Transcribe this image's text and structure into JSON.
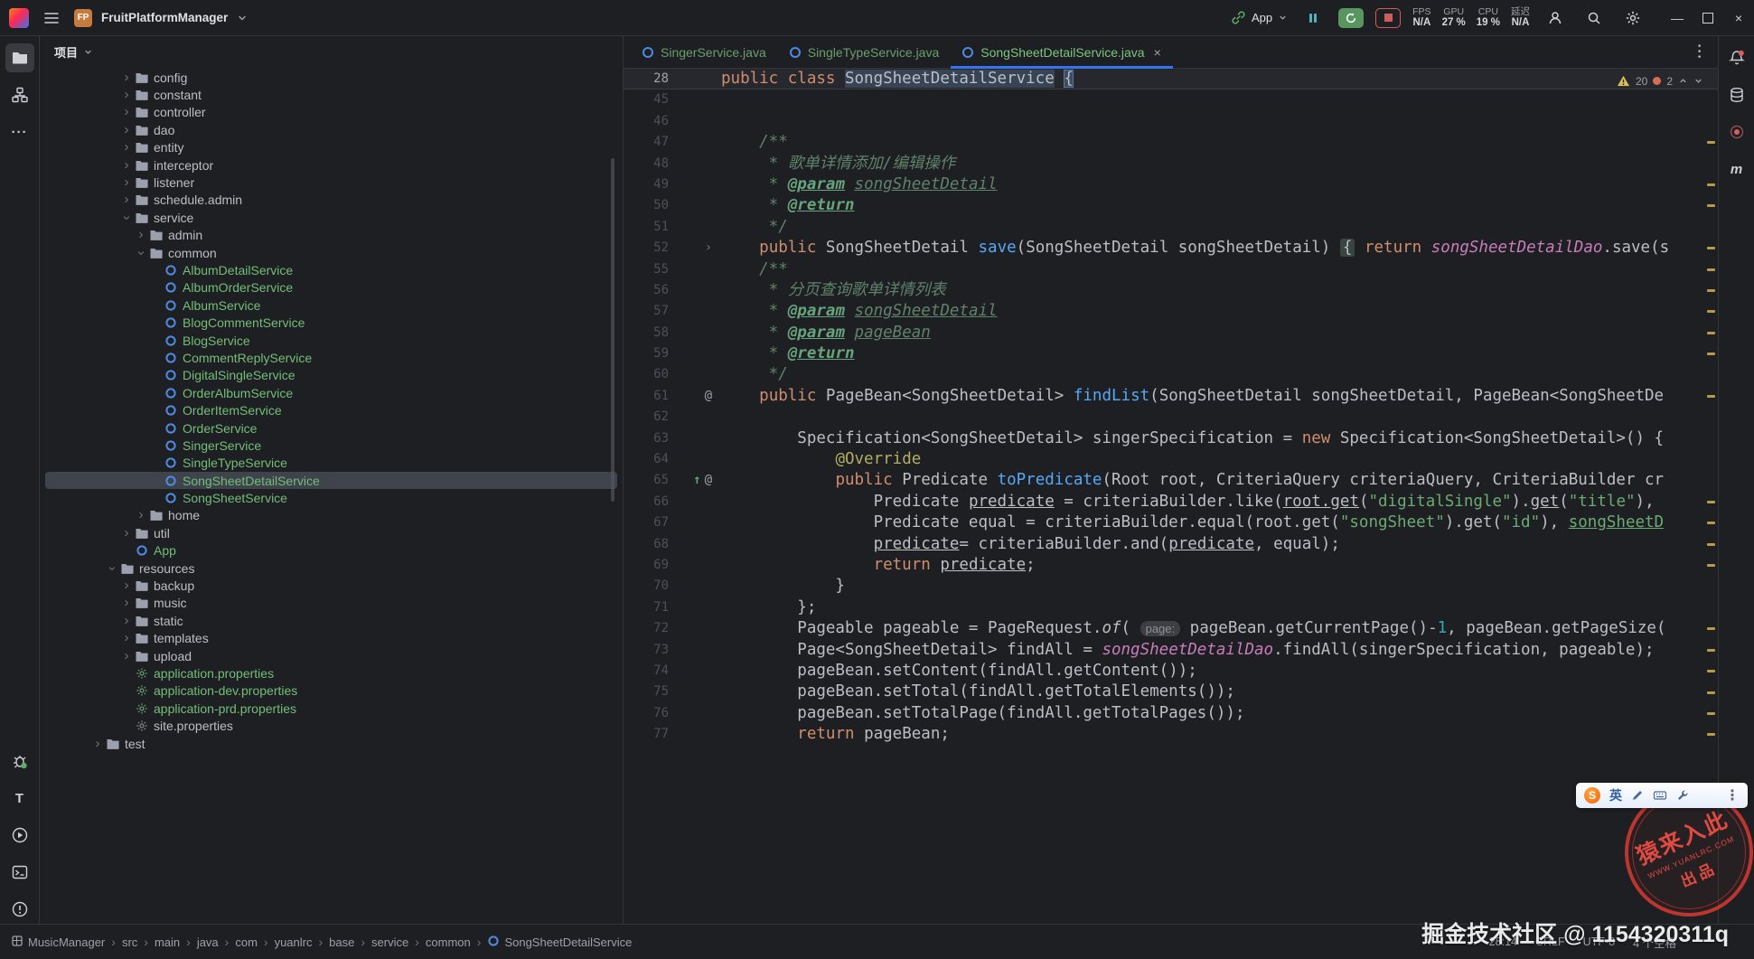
{
  "colors": {
    "accent": "#3574F0",
    "vcs_added_green": "#73BD79",
    "keyword": "#CF8E6D",
    "string": "#6AAB73",
    "comment": "#5F826B",
    "method": "#56A8F5",
    "field": "#C77DBB",
    "annotation": "#B3AE60",
    "warning_stripe": "#C8A94E",
    "stop_red": "#D05B5B",
    "run_green": "#57965C"
  },
  "titlebar": {
    "project_badge": "FP",
    "project_name": "FruitPlatformManager",
    "run_widget": {
      "config_name": "App"
    },
    "perf": [
      {
        "label": "FPS",
        "value": "N/A"
      },
      {
        "label": "GPU",
        "value": "27 %"
      },
      {
        "label": "CPU",
        "value": "19 %"
      },
      {
        "label": "延迟",
        "value": "N/A"
      }
    ]
  },
  "left_strip": {
    "top": [
      "project-icon",
      "structure-icon",
      "more-icon"
    ],
    "bottom": [
      "debug-icon",
      "translate-icon",
      "run-icon",
      "terminal-icon",
      "problems-icon"
    ]
  },
  "right_strip": {
    "top": [
      "notifications-icon",
      "database-icon",
      "profiler-icon",
      "maven-icon"
    ]
  },
  "project_panel": {
    "title": "项目",
    "tree": [
      {
        "label": "config",
        "icon": "folder",
        "chev": "right",
        "indent": 5
      },
      {
        "label": "constant",
        "icon": "folder",
        "chev": "right",
        "indent": 5
      },
      {
        "label": "controller",
        "icon": "folder",
        "chev": "right",
        "indent": 5
      },
      {
        "label": "dao",
        "icon": "folder",
        "chev": "right",
        "indent": 5
      },
      {
        "label": "entity",
        "icon": "folder",
        "chev": "right",
        "indent": 5
      },
      {
        "label": "interceptor",
        "icon": "folder",
        "chev": "right",
        "indent": 5
      },
      {
        "label": "listener",
        "icon": "folder",
        "chev": "right",
        "indent": 5
      },
      {
        "label": "schedule.admin",
        "icon": "folder",
        "chev": "right",
        "indent": 5
      },
      {
        "label": "service",
        "icon": "folder",
        "chev": "down",
        "indent": 5
      },
      {
        "label": "admin",
        "icon": "folder",
        "chev": "right",
        "indent": 6
      },
      {
        "label": "common",
        "icon": "folder",
        "chev": "down",
        "indent": 6
      },
      {
        "label": "AlbumDetailService",
        "icon": "class",
        "indent": 7,
        "green": true
      },
      {
        "label": "AlbumOrderService",
        "icon": "class",
        "indent": 7,
        "green": true
      },
      {
        "label": "AlbumService",
        "icon": "class",
        "indent": 7,
        "green": true
      },
      {
        "label": "BlogCommentService",
        "icon": "class",
        "indent": 7,
        "green": true
      },
      {
        "label": "BlogService",
        "icon": "class",
        "indent": 7,
        "green": true
      },
      {
        "label": "CommentReplyService",
        "icon": "class",
        "indent": 7,
        "green": true
      },
      {
        "label": "DigitalSingleService",
        "icon": "class",
        "indent": 7,
        "green": true
      },
      {
        "label": "OrderAlbumService",
        "icon": "class",
        "indent": 7,
        "green": true
      },
      {
        "label": "OrderItemService",
        "icon": "class",
        "indent": 7,
        "green": true
      },
      {
        "label": "OrderService",
        "icon": "class",
        "indent": 7,
        "green": true
      },
      {
        "label": "SingerService",
        "icon": "class",
        "indent": 7,
        "green": true
      },
      {
        "label": "SingleTypeService",
        "icon": "class",
        "indent": 7,
        "green": true
      },
      {
        "label": "SongSheetDetailService",
        "icon": "class",
        "indent": 7,
        "green": true,
        "selected": true
      },
      {
        "label": "SongSheetService",
        "icon": "class",
        "indent": 7,
        "green": true
      },
      {
        "label": "home",
        "icon": "folder",
        "chev": "right",
        "indent": 6
      },
      {
        "label": "util",
        "icon": "folder",
        "chev": "right",
        "indent": 5
      },
      {
        "label": "App",
        "icon": "class",
        "indent": 5,
        "green": true
      },
      {
        "label": "resources",
        "icon": "folder",
        "chev": "down",
        "indent": 4
      },
      {
        "label": "backup",
        "icon": "folder",
        "chev": "right",
        "indent": 5
      },
      {
        "label": "music",
        "icon": "folder",
        "chev": "right",
        "indent": 5
      },
      {
        "label": "static",
        "icon": "folder",
        "chev": "right",
        "indent": 5
      },
      {
        "label": "templates",
        "icon": "folder",
        "chev": "right",
        "indent": 5
      },
      {
        "label": "upload",
        "icon": "folder",
        "chev": "right",
        "indent": 5
      },
      {
        "label": "application.properties",
        "icon": "props",
        "indent": 5,
        "green": true
      },
      {
        "label": "application-dev.properties",
        "icon": "props",
        "indent": 5,
        "green": true
      },
      {
        "label": "application-prd.properties",
        "icon": "props",
        "indent": 5,
        "green": true
      },
      {
        "label": "site.properties",
        "icon": "props",
        "indent": 5
      },
      {
        "label": "test",
        "icon": "folder",
        "chev": "right",
        "indent": 3
      }
    ]
  },
  "tabs": [
    {
      "label": "SingerService.java",
      "active": false
    },
    {
      "label": "SingleTypeService.java",
      "active": false
    },
    {
      "label": "SongSheetDetailService.java",
      "active": true
    }
  ],
  "editor": {
    "inspection": {
      "warnings": "20",
      "weak": "2"
    },
    "lines": [
      {
        "n": "28",
        "g": "",
        "segs": [
          [
            "public class ",
            "k"
          ],
          [
            "SongSheetDetailService",
            "p hl"
          ],
          [
            " ",
            "p"
          ],
          [
            "{",
            "p brace"
          ]
        ]
      },
      {
        "n": "45",
        "g": "",
        "segs": []
      },
      {
        "n": "46",
        "g": "",
        "segs": []
      },
      {
        "n": "47",
        "g": "",
        "segs": [
          [
            "    /**",
            "d"
          ]
        ]
      },
      {
        "n": "48",
        "g": "",
        "segs": [
          [
            "     * 歌单详情添加/编辑操作",
            "d"
          ]
        ]
      },
      {
        "n": "49",
        "g": "",
        "segs": [
          [
            "     * ",
            "d"
          ],
          [
            "@param",
            "dt"
          ],
          [
            " ",
            "d"
          ],
          [
            "songSheetDetail",
            "dv"
          ]
        ]
      },
      {
        "n": "50",
        "g": "",
        "segs": [
          [
            "     * ",
            "d"
          ],
          [
            "@return",
            "dt"
          ]
        ]
      },
      {
        "n": "51",
        "g": "",
        "segs": [
          [
            "     */",
            "d"
          ]
        ]
      },
      {
        "n": "52",
        "g": "fold",
        "segs": [
          [
            "    ",
            "p"
          ],
          [
            "public ",
            "k"
          ],
          [
            "SongSheetDetail ",
            "p"
          ],
          [
            "save",
            "m"
          ],
          [
            "(SongSheetDetail songSheetDetail) ",
            "p"
          ],
          [
            "{",
            "fold"
          ],
          [
            " ",
            "p"
          ],
          [
            "return ",
            "k"
          ],
          [
            "songSheetDetailDao",
            "f"
          ],
          [
            ".save(s",
            "p"
          ]
        ]
      },
      {
        "n": "55",
        "g": "",
        "segs": [
          [
            "    /**",
            "d"
          ]
        ]
      },
      {
        "n": "56",
        "g": "",
        "segs": [
          [
            "     * 分页查询歌单详情列表",
            "d"
          ]
        ]
      },
      {
        "n": "57",
        "g": "",
        "segs": [
          [
            "     * ",
            "d"
          ],
          [
            "@param",
            "dt"
          ],
          [
            " ",
            "d"
          ],
          [
            "songSheetDetail",
            "dv"
          ]
        ]
      },
      {
        "n": "58",
        "g": "",
        "segs": [
          [
            "     * ",
            "d"
          ],
          [
            "@param",
            "dt"
          ],
          [
            " ",
            "d"
          ],
          [
            "pageBean",
            "dv"
          ]
        ]
      },
      {
        "n": "59",
        "g": "",
        "segs": [
          [
            "     * ",
            "d"
          ],
          [
            "@return",
            "dt"
          ]
        ]
      },
      {
        "n": "60",
        "g": "",
        "segs": [
          [
            "     */",
            "d"
          ]
        ]
      },
      {
        "n": "61",
        "g": "at",
        "segs": [
          [
            "    ",
            "p"
          ],
          [
            "public ",
            "k"
          ],
          [
            "PageBean<SongSheetDetail> ",
            "p"
          ],
          [
            "findList",
            "m"
          ],
          [
            "(SongSheetDetail songSheetDetail, PageBean<SongSheetDe",
            "p"
          ]
        ]
      },
      {
        "n": "62",
        "g": "",
        "segs": []
      },
      {
        "n": "63",
        "g": "",
        "segs": [
          [
            "        Specification<SongSheetDetail> singerSpecification = ",
            "p"
          ],
          [
            "new ",
            "k"
          ],
          [
            "Specification<SongSheetDetail>() {",
            "p"
          ]
        ]
      },
      {
        "n": "64",
        "g": "",
        "segs": [
          [
            "            ",
            "p"
          ],
          [
            "@Override",
            "a"
          ]
        ]
      },
      {
        "n": "65",
        "g": "ovr at",
        "segs": [
          [
            "            ",
            "p"
          ],
          [
            "public ",
            "k"
          ],
          [
            "Predicate ",
            "p"
          ],
          [
            "toPredicate",
            "m"
          ],
          [
            "(Root root, CriteriaQuery criteriaQuery, CriteriaBuilder cr",
            "p"
          ]
        ]
      },
      {
        "n": "66",
        "g": "",
        "segs": [
          [
            "                Predicate ",
            "p"
          ],
          [
            "predicate",
            "p u"
          ],
          [
            " = criteriaBuilder.like(",
            "p"
          ],
          [
            "root.get",
            "p u"
          ],
          [
            "(",
            "p"
          ],
          [
            "\"digitalSingle\"",
            "s"
          ],
          [
            ").",
            "p"
          ],
          [
            "get",
            "p u"
          ],
          [
            "(",
            "p"
          ],
          [
            "\"title\"",
            "s"
          ],
          [
            "),",
            "p"
          ]
        ]
      },
      {
        "n": "67",
        "g": "",
        "segs": [
          [
            "                Predicate equal = criteriaBuilder.equal(root.get(",
            "p"
          ],
          [
            "\"songSheet\"",
            "s"
          ],
          [
            ").get(",
            "p"
          ],
          [
            "\"id\"",
            "s"
          ],
          [
            "), ",
            "p"
          ],
          [
            "songSheetD",
            "lnk"
          ]
        ]
      },
      {
        "n": "68",
        "g": "",
        "segs": [
          [
            "                ",
            "p"
          ],
          [
            "predicate",
            "p u"
          ],
          [
            "= criteriaBuilder.and(",
            "p"
          ],
          [
            "predicate",
            "p u"
          ],
          [
            ", equal);",
            "p"
          ]
        ]
      },
      {
        "n": "69",
        "g": "",
        "segs": [
          [
            "                ",
            "p"
          ],
          [
            "return ",
            "k"
          ],
          [
            "predicate",
            "p u"
          ],
          [
            ";",
            "p"
          ]
        ]
      },
      {
        "n": "70",
        "g": "",
        "segs": [
          [
            "            }",
            "p"
          ]
        ]
      },
      {
        "n": "71",
        "g": "",
        "segs": [
          [
            "        };",
            "p"
          ]
        ]
      },
      {
        "n": "72",
        "g": "",
        "segs": [
          [
            "        Pageable pageable = PageRequest.",
            "p"
          ],
          [
            "of",
            "p it"
          ],
          [
            "( ",
            "p"
          ],
          [
            "page:",
            "hint"
          ],
          [
            " pageBean.getCurrentPage()-",
            "p"
          ],
          [
            "1",
            "n"
          ],
          [
            ", pageBean.getPageSize(",
            "p"
          ]
        ]
      },
      {
        "n": "73",
        "g": "",
        "segs": [
          [
            "        Page<SongSheetDetail> findAll = ",
            "p"
          ],
          [
            "songSheetDetailDao",
            "f"
          ],
          [
            ".findAll(singerSpecification, pageable);",
            "p"
          ]
        ]
      },
      {
        "n": "74",
        "g": "",
        "segs": [
          [
            "        pageBean.setContent(findAll.getContent());",
            "p"
          ]
        ]
      },
      {
        "n": "75",
        "g": "",
        "segs": [
          [
            "        pageBean.setTotal(findAll.getTotalElements());",
            "p"
          ]
        ]
      },
      {
        "n": "76",
        "g": "",
        "segs": [
          [
            "        pageBean.setTotalPage(findAll.getTotalPages());",
            "p"
          ]
        ]
      },
      {
        "n": "77",
        "g": "",
        "segs": [
          [
            "        ",
            "p"
          ],
          [
            "return ",
            "k"
          ],
          [
            "pageBean;",
            "p"
          ]
        ]
      }
    ]
  },
  "navbar": {
    "items": [
      "MusicManager",
      "src",
      "main",
      "java",
      "com",
      "yuanlrc",
      "base",
      "service",
      "common",
      "SongSheetDetailService"
    ]
  },
  "status": {
    "caret": "28:14",
    "line_ending": "CRLF",
    "encoding": "UTF-8",
    "indent": "4 个空格"
  },
  "watermark": {
    "banner": "掘金技术社区 @ 1154320311q",
    "stamp_title": "猿来入此",
    "stamp_site": "WWW.YUANLRC.COM",
    "stamp_footer": "出品"
  },
  "ime": {
    "logo": "S",
    "lang": "英"
  }
}
